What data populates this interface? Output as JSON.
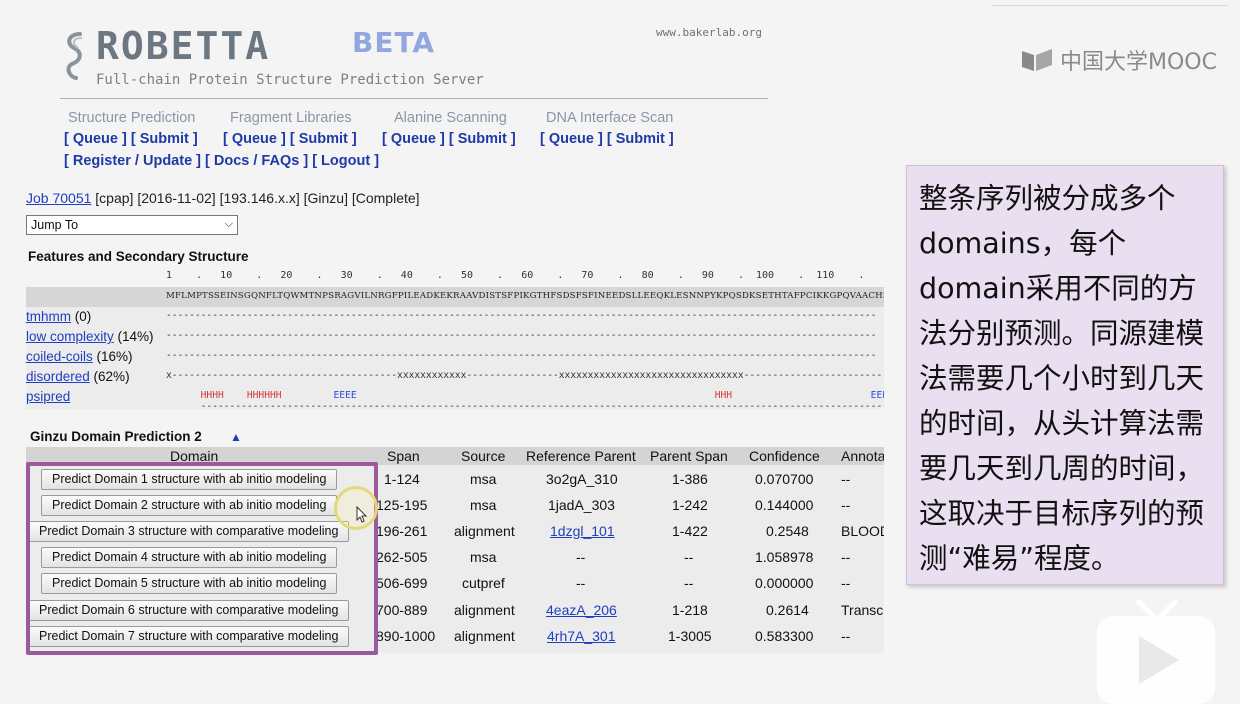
{
  "header": {
    "title": "ROBETTA",
    "beta": "BETA",
    "subtitle": "Full-chain Protein Structure Prediction Server",
    "url": "www.bakerlab.org"
  },
  "nav": {
    "categories": [
      "Structure Prediction",
      "Fragment Libraries",
      "Alanine Scanning",
      "DNA Interface Scan"
    ],
    "queue": "[ Queue ]",
    "submit": "[ Submit ]",
    "register": "[ Register",
    "slash": "/",
    "update": "Update ]",
    "docs": "[ Docs / FAQs ]",
    "logout": "[ Logout ]"
  },
  "job": {
    "link": "Job 70051",
    "info": "[cpap] [2016-11-02] [193.146.x.x] [Ginzu] [Complete]",
    "jump_to": "Jump To"
  },
  "features": {
    "title": "Features and Secondary Structure",
    "ruler": "1    .   10    .   20    .   30    .   40    .   50    .   60    .   70    .   80    .   90    .  100    .  110    .",
    "sequence": "MFLMPTSSEINSGQNFLTQWMTNPSRAGVILNRGFPILEADKEKRAAVDISTSFPIKGTHFSDSFSFINEEDSLLEEQKLESNNPYKPQSDKSETHTAFPCIKKGPQVAACHSAPGKDQSEIPCKNR",
    "rows": [
      {
        "name": "tmhmm",
        "value": " (0)"
      },
      {
        "name": "low complexity",
        "value": " (14%)"
      },
      {
        "name": "coiled-coils",
        "value": " (16%)"
      },
      {
        "name": "disordered",
        "value": " (62%)"
      },
      {
        "name": "psipred",
        "value": ""
      }
    ],
    "tracks": {
      "tmhmm": "---------------------------------------------------------------------------------------------------------------------------",
      "low_complexity": "---------------------------------------------------------------------------------------------------------------------------",
      "coiled_coils": "---------------------------------------------------------------------------------------------------------------------------",
      "disordered_a": "x---------------------------------------",
      "disordered_b": "xxxxxxxxxxxx",
      "disordered_c": "----------------",
      "disordered_d": "xxxxxxxxxxxxxxxxxxxxxxxxxxxxxxxx",
      "disordered_e": "--------------------------------",
      "psipred_dash": "---------------------------------------------------------------------------------------------------------------------------",
      "helix_a": "HHHH",
      "helix_b": "HHHHHH",
      "strand_a": "EEEE",
      "helix_c": "HHH",
      "strand_b": "EEEE"
    },
    "colors": {
      "helix": "#d23b3b",
      "strand": "#2a4dd8"
    }
  },
  "ginzu": {
    "title": "Ginzu Domain Prediction 2",
    "toggle_icon": "▲",
    "headers": [
      "Domain",
      "Span",
      "Source",
      "Reference Parent",
      "Parent Span",
      "Confidence",
      "Annota"
    ],
    "rows": [
      {
        "button": "Predict Domain 1 structure with ab initio modeling",
        "span": "1-124",
        "source": "msa",
        "parent": "3o2gA_310",
        "parent_span": "1-386",
        "confidence": "0.070700",
        "annotation": "--"
      },
      {
        "button": "Predict Domain 2 structure with ab initio modeling",
        "span": "125-195",
        "source": "msa",
        "parent": "1jadA_303",
        "parent_span": "1-242",
        "confidence": "0.144000",
        "annotation": "--"
      },
      {
        "button": "Predict Domain 3 structure with comparative modeling",
        "span": "196-261",
        "source": "alignment",
        "parent": "1dzgl_101",
        "parent_span": "1-422",
        "confidence": "0.2548",
        "annotation": "BLOOD"
      },
      {
        "button": "Predict Domain 4 structure with ab initio modeling",
        "span": "262-505",
        "source": "msa",
        "parent": "--",
        "parent_span": "--",
        "confidence": "1.058978",
        "annotation": "--"
      },
      {
        "button": "Predict Domain 5 structure with ab initio modeling",
        "span": "506-699",
        "source": "cutpref",
        "parent": "--",
        "parent_span": "--",
        "confidence": "0.000000",
        "annotation": "--"
      },
      {
        "button": "Predict Domain 6 structure with comparative modeling",
        "span": "700-889",
        "source": "alignment",
        "parent": "4eazA_206",
        "parent_span": "1-218",
        "confidence": "0.2614",
        "annotation": "Transc"
      },
      {
        "button": "Predict Domain 7 structure with comparative modeling",
        "span": "890-1000",
        "source": "alignment",
        "parent": "4rh7A_301",
        "parent_span": "1-3005",
        "confidence": "0.583300",
        "annotation": "--"
      }
    ]
  },
  "note": {
    "text": "整条序列被分成多个domains，每个domain采用不同的方法分别预测。同源建模法需要几个小时到几天的时间，从头计算法需要几天到几周的时间，这取决于目标序列的预测“难易”程度。",
    "accent": "#9b5a9b"
  },
  "brand": {
    "text": "中国大学MOOC"
  }
}
